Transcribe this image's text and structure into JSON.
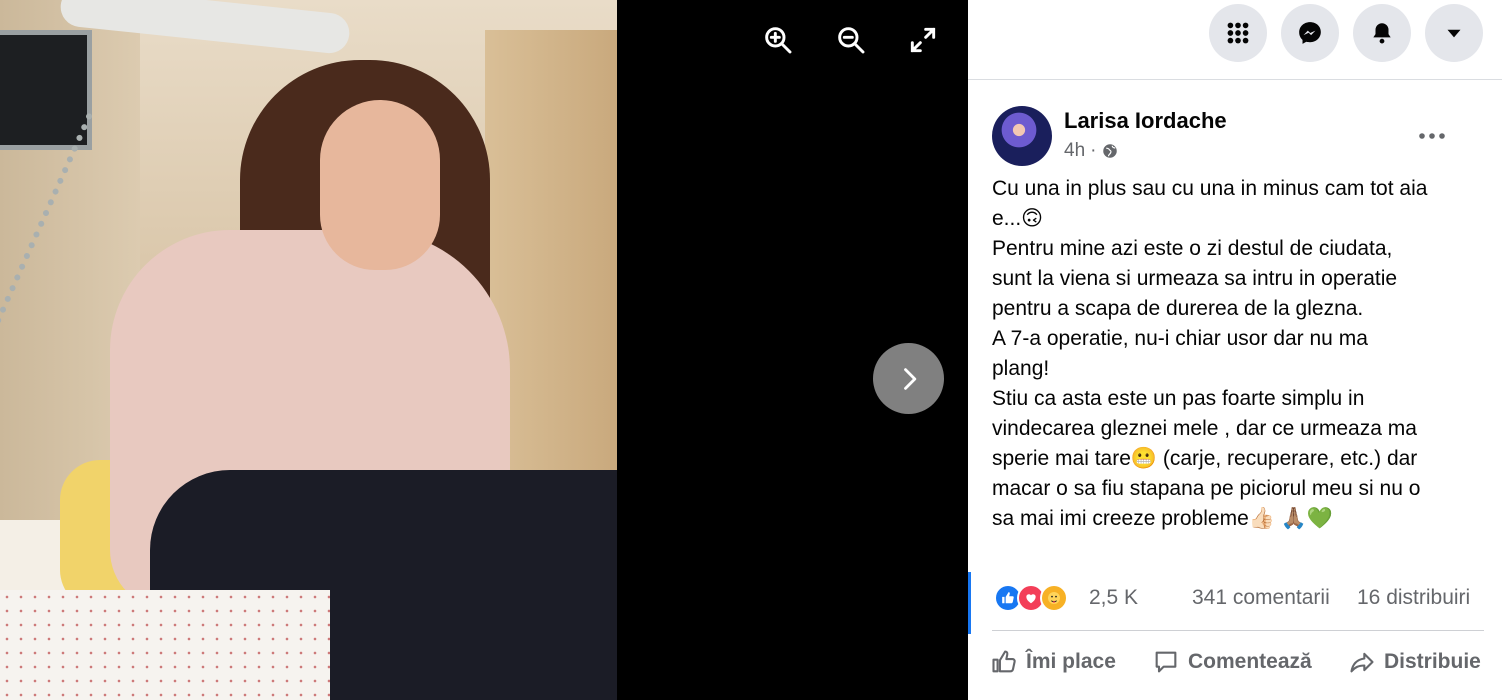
{
  "viewer": {
    "zoom_in_icon": "zoom-in-icon",
    "zoom_out_icon": "zoom-out-icon",
    "fullscreen_icon": "fullscreen-icon",
    "next_icon": "chevron-right-icon"
  },
  "topbar": {
    "menu_icon": "grid-menu-icon",
    "messenger_icon": "messenger-icon",
    "notifications_icon": "bell-icon",
    "account_icon": "caret-down-icon"
  },
  "post": {
    "author": "Larisa Iordache",
    "time": "4h",
    "audience_icon": "globe-icon",
    "separator": "·",
    "text_lines": [
      "Cu una in plus sau cu una in minus cam tot aia",
      "e...🙃",
      "Pentru mine azi este o zi destul de ciudata,",
      "sunt la viena si urmeaza sa intru in operatie",
      "pentru a scapa de durerea de la glezna.",
      "A 7-a operatie, nu-i chiar usor dar nu ma",
      "plang!",
      "Stiu ca asta este un pas foarte simplu in",
      "vindecarea gleznei mele , dar ce urmeaza ma",
      "sperie mai tare😬 (carje, recuperare, etc.) dar",
      "macar o sa fiu stapana pe piciorul meu si nu o",
      "sa mai imi creeze probleme👍🏻 🙏🏽💚"
    ],
    "reactions_count": "2,5 K",
    "comments": "341 comentarii",
    "shares": "16 distribuiri",
    "actions": {
      "like": "Îmi place",
      "comment": "Comentează",
      "share": "Distribuie"
    }
  },
  "colors": {
    "accent": "#1877f2",
    "secondary_text": "#65676b",
    "love": "#f33e58",
    "care": "#f7b125"
  }
}
